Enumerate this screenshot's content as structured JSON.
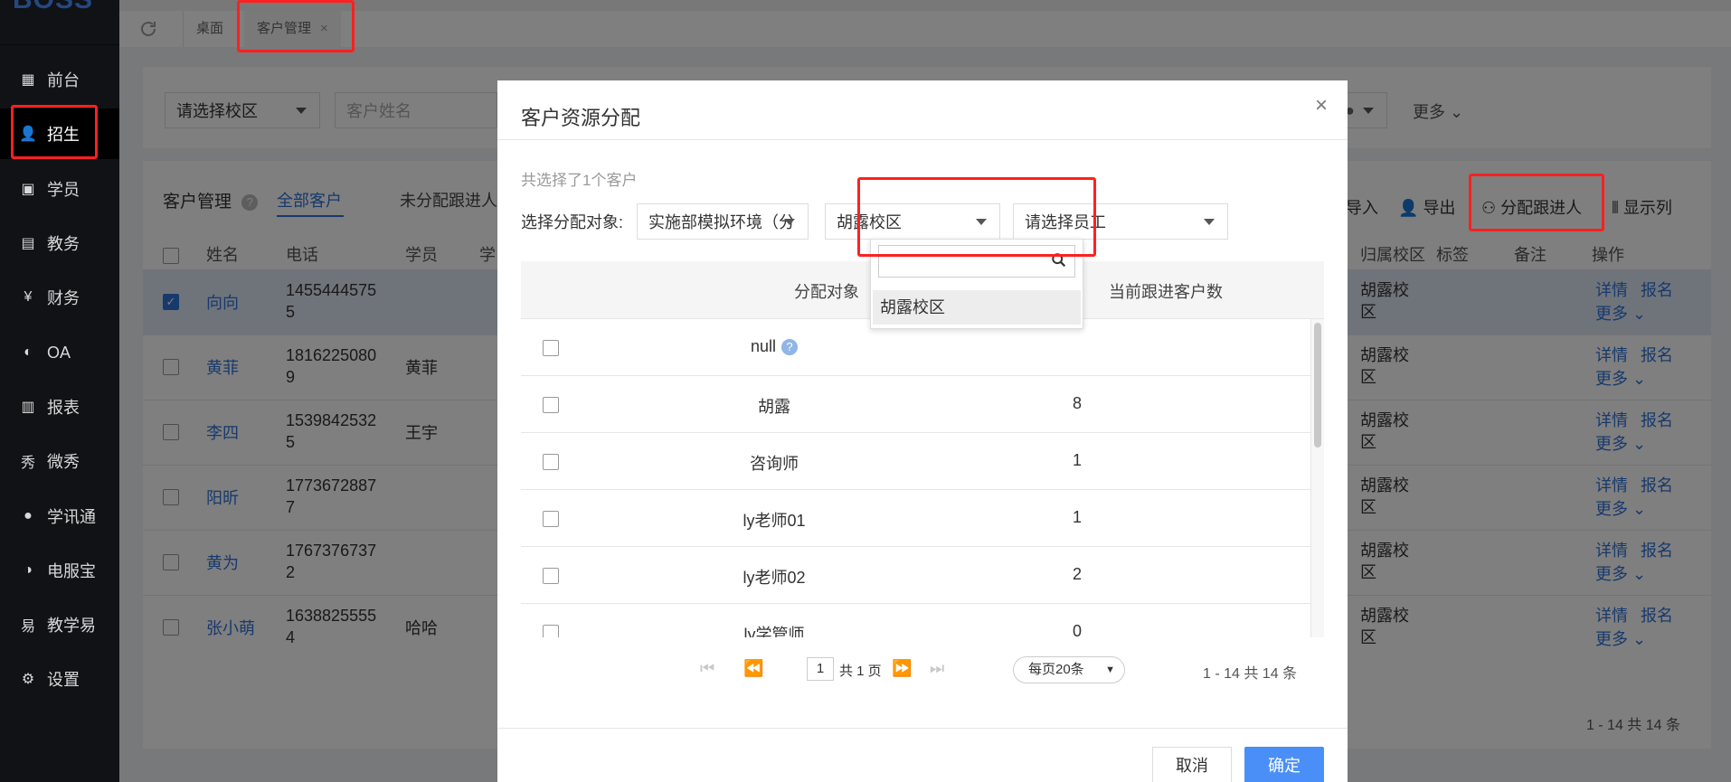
{
  "brand": {
    "logo": "BOSS"
  },
  "sidebar": {
    "items": [
      {
        "label": "前台",
        "icon": "calendar-icon"
      },
      {
        "label": "招生",
        "icon": "user-add-icon"
      },
      {
        "label": "学员",
        "icon": "student-icon"
      },
      {
        "label": "教务",
        "icon": "book-icon"
      },
      {
        "label": "财务",
        "icon": "yen-icon"
      },
      {
        "label": "OA",
        "icon": "oa-icon"
      },
      {
        "label": "报表",
        "icon": "bar-chart-icon"
      },
      {
        "label": "微秀",
        "icon": "weixiu-icon"
      },
      {
        "label": "学讯通",
        "icon": "location-icon"
      },
      {
        "label": "电服宝",
        "icon": "phone-service-icon"
      },
      {
        "label": "教学易",
        "icon": "teach-icon"
      },
      {
        "label": "设置",
        "icon": "gear-icon"
      }
    ],
    "active_index": 1
  },
  "tabbar": {
    "desktop": "桌面",
    "customer": "客户管理",
    "close": "×"
  },
  "filter": {
    "campus_placeholder": "请选择校区",
    "name_placeholder": "客户姓名",
    "more": "更多"
  },
  "list": {
    "title": "客户管理",
    "tabs": [
      "全部客户",
      "未分配跟进人"
    ],
    "actions": [
      "导入",
      "导出",
      "分配跟进人",
      "显示列"
    ],
    "columns": [
      "姓名",
      "电话",
      "学员",
      "学",
      "归属校区",
      "标签",
      "备注",
      "操作"
    ],
    "rows": [
      {
        "name": "向向",
        "phone": "14554445755",
        "student": "",
        "campus": "胡露校区",
        "selected": true
      },
      {
        "name": "黄菲",
        "phone": "18162250809",
        "student": "黄菲",
        "campus": "胡露校区",
        "selected": false
      },
      {
        "name": "李四",
        "phone": "15398425325",
        "student": "王宇",
        "campus": "胡露校区",
        "selected": false
      },
      {
        "name": "阳昕",
        "phone": "17736728877",
        "student": "",
        "campus": "胡露校区",
        "selected": false
      },
      {
        "name": "黄为",
        "phone": "17673767372",
        "student": "",
        "campus": "胡露校区",
        "selected": false
      },
      {
        "name": "张小萌",
        "phone": "16388255554",
        "student": "哈哈",
        "campus": "胡露校区",
        "selected": false
      }
    ],
    "op_detail": "详情",
    "op_enroll": "报名",
    "op_more": "更多",
    "footer": "1 - 14   共 14 条"
  },
  "modal": {
    "title": "客户资源分配",
    "close": "×",
    "selected_text": "共选择了1个客户",
    "assign_label": "选择分配对象:",
    "select_dept": "实施部模拟环境（分公…",
    "select_campus": "胡露校区",
    "select_staff": "请选择员工",
    "col_target": "分配对象",
    "col_count": "当前跟进客户数",
    "rows": [
      {
        "name": "null",
        "count": "",
        "help": true
      },
      {
        "name": "胡露",
        "count": "8"
      },
      {
        "name": "咨询师",
        "count": "1"
      },
      {
        "name": "ly老师01",
        "count": "1"
      },
      {
        "name": "ly老师02",
        "count": "2"
      },
      {
        "name": "ly学管师",
        "count": "0"
      }
    ],
    "pager": {
      "page": "1",
      "total_pages": "共 1 页",
      "page_size": "每页20条",
      "range": "1 - 14   共 14 条"
    },
    "cancel": "取消",
    "ok": "确定",
    "dropdown": {
      "search_value": "",
      "options": [
        "胡露校区"
      ]
    }
  },
  "colors": {
    "accent": "#2f73d8",
    "primary_btn": "#4a8ff7",
    "highlight": "#ff2020"
  }
}
